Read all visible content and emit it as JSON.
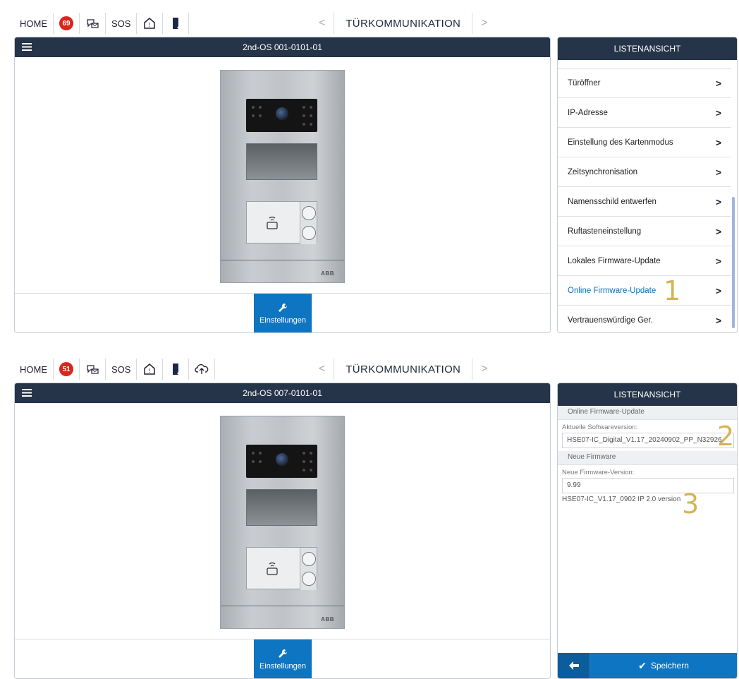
{
  "screens": [
    {
      "nav": {
        "home": "HOME",
        "badge": "69",
        "sos": "SOS",
        "title": "TÜRKOMMUNIKATION",
        "show_cloud": false
      },
      "panel_title": "2nd-OS 001-0101-01",
      "settings_label": "Einstellungen",
      "side_title": "LISTENANSICHT",
      "list": [
        {
          "label": "Türöffner"
        },
        {
          "label": "IP-Adresse"
        },
        {
          "label": "Einstellung des Kartenmodus"
        },
        {
          "label": "Zeitsynchronisation"
        },
        {
          "label": "Namensschild entwerfen"
        },
        {
          "label": "Ruftasteneinstellung"
        },
        {
          "label": "Lokales Firmware-Update"
        },
        {
          "label": "Online Firmware-Update",
          "active": true
        },
        {
          "label": "Vertrauenswürdige Ger."
        }
      ],
      "marker": "1"
    },
    {
      "nav": {
        "home": "HOME",
        "badge": "51",
        "sos": "SOS",
        "title": "TÜRKOMMUNIKATION",
        "show_cloud": true
      },
      "panel_title": "2nd-OS 007-0101-01",
      "settings_label": "Einstellungen",
      "side_title": "LISTENANSICHT",
      "form": {
        "section1": "Online Firmware-Update",
        "current_label": "Aktuelle Softwareversion:",
        "current_value": "HSE07-IC_Digital_V1.17_20240902_PP_N32926",
        "section2": "Neue Firmware",
        "new_label": "Neue Firmware-Version:",
        "new_value": "9.99",
        "new_note": "HSE07-IC_V1.17_0902 IP 2.0 version"
      },
      "markers": [
        "2",
        "3"
      ],
      "save_label": "Speichern"
    }
  ],
  "colors": {
    "header": "#253449",
    "accent": "#0e75c2",
    "badge": "#d9261c",
    "marker": "#d6b455"
  }
}
